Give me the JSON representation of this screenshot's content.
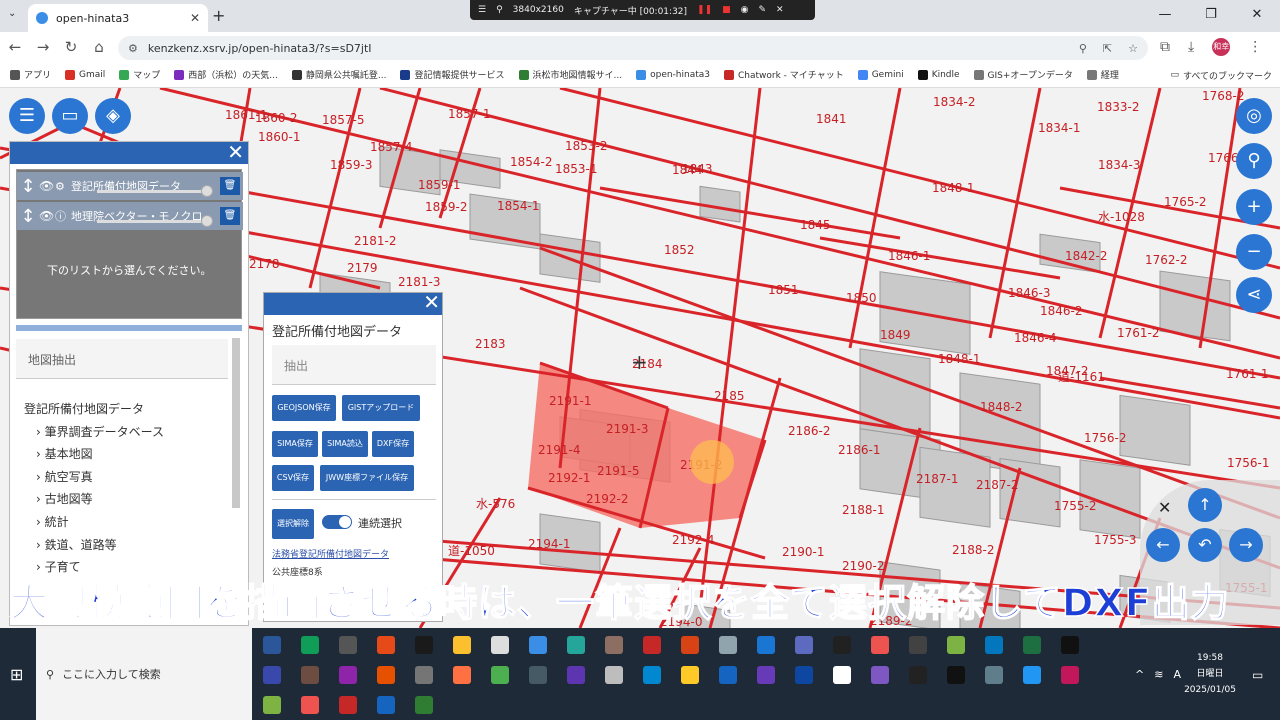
{
  "browser": {
    "tab_title": "open-hinata3",
    "url": "kenzkenz.xsrv.jp/open-hinata3/?s=sD7jtI",
    "avatar_text": "和幸",
    "capture": {
      "resolution": "3840x2160",
      "status": "キャプチャー中 [00:01:32]"
    },
    "bookmarks": [
      {
        "label": "アプリ",
        "color": "#555"
      },
      {
        "label": "Gmail",
        "color": "#d93025"
      },
      {
        "label": "マップ",
        "color": "#34a853"
      },
      {
        "label": "西部（浜松）の天気...",
        "color": "#7b2cbf"
      },
      {
        "label": "静岡県公共嘱託登...",
        "color": "#333"
      },
      {
        "label": "登記情報提供サービス",
        "color": "#1a3a8a"
      },
      {
        "label": "浜松市地図情報サイ...",
        "color": "#2e7d32"
      },
      {
        "label": "open-hinata3",
        "color": "#3a8ee6"
      },
      {
        "label": "Chatwork - マイチャット",
        "color": "#c62828"
      },
      {
        "label": "Gemini",
        "color": "#4285f4"
      },
      {
        "label": "Kindle",
        "color": "#111"
      },
      {
        "label": "GIS+オープンデータ",
        "color": "#777"
      },
      {
        "label": "経理",
        "color": "#777"
      }
    ],
    "all_bookmarks": "すべてのブックマーク"
  },
  "left_panel": {
    "layers": [
      {
        "name": "登記所備付地図データ",
        "icon": "gear-icon"
      },
      {
        "name": "地理院ベクター・モノクロ",
        "icon": "info-icon"
      }
    ],
    "hint": "下のリストから選んでください。",
    "extract_label": "地図抽出",
    "categories": [
      "登記所備付地図データ",
      "筆界調査データベース",
      "基本地図",
      "航空写真",
      "古地図等",
      "統計",
      "鉄道、道路等",
      "子育て"
    ]
  },
  "right_panel": {
    "title": "登記所備付地図データ",
    "extract_label": "抽出",
    "buttons": {
      "geojson": "GEOJSON保存",
      "gist": "GISTアップロード",
      "sima_save": "SIMA保存",
      "sima_read": "SIMA読込",
      "dxf": "DXF保存",
      "csv": "CSV保存",
      "jww": "JWW座標ファイル保存",
      "deselect": "選択解除"
    },
    "continuous_label": "連続選択",
    "continuous_on": true,
    "link": "法務省登記所備付地図データ",
    "coord_system": "公共座標8系"
  },
  "map": {
    "parcel_labels": [
      "1861-1",
      "1860-2",
      "1860-1",
      "1857-5",
      "1857-1",
      "1857-4",
      "1859-3",
      "1859-1",
      "1859-2",
      "1854-2",
      "1853-2",
      "1853-1",
      "1854-1",
      "1843",
      "1841",
      "1834-2",
      "1834-1",
      "1833-2",
      "1768-2",
      "1844",
      "1848-1",
      "1834-3",
      "1766-2",
      "1845",
      "1765-2",
      "水-1028",
      "2181-2",
      "2178",
      "2179",
      "2181-3",
      "1852",
      "1846-1",
      "1842-2",
      "1762-2",
      "1851",
      "1850",
      "1846-3",
      "2183",
      "1849",
      "1846-4",
      "1848-1",
      "1846-2",
      "1761-2",
      "2184",
      "1847-2",
      "道-1161",
      "1761-1",
      "2191-1",
      "2185",
      "1848-2",
      "2191-3",
      "2186-2",
      "1756-2",
      "2191-4",
      "2191-2",
      "2192-1",
      "2191-5",
      "2186-1",
      "2187-1",
      "1756-1",
      "水-576",
      "2192-2",
      "2187-2",
      "1755-2",
      "2188-1",
      "2194-1",
      "2192-4",
      "2190-1",
      "2190-2",
      "2188-2",
      "1755-3",
      "道-1050",
      "1755-1",
      "2194-0",
      "2189-2"
    ]
  },
  "caption": "大規模範囲を描画させる時は、一筆選択を全て選択解除してDXF出力",
  "taskbar": {
    "search_placeholder": "ここに入力して検索",
    "time": "19:58",
    "weekday": "日曜日",
    "date": "2025/01/05",
    "ime": "A"
  }
}
